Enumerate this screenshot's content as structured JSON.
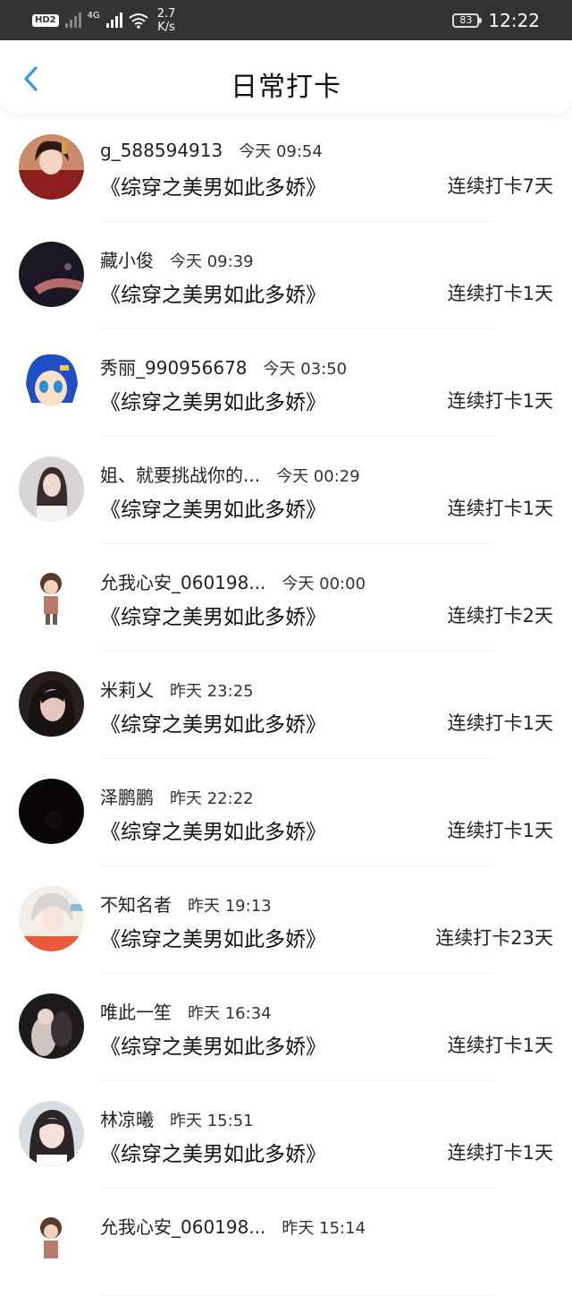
{
  "status_bar": {
    "hd": "HD",
    "sim": "2",
    "network": "4G",
    "speed_value": "2.7",
    "speed_unit": "K/s",
    "battery": "83",
    "time": "12:22"
  },
  "header": {
    "title": "日常打卡"
  },
  "colors": {
    "accent": "#2b9bf4",
    "status_bar_bg": "#333333"
  },
  "entries": [
    {
      "name": "g_588594913",
      "time": "今天 09:54",
      "book": "《综穿之美男如此多娇》",
      "streak": "连续打卡7天"
    },
    {
      "name": "藏小俊",
      "time": "今天 09:39",
      "book": "《综穿之美男如此多娇》",
      "streak": "连续打卡1天"
    },
    {
      "name": "秀丽_990956678",
      "time": "今天 03:50",
      "book": "《综穿之美男如此多娇》",
      "streak": "连续打卡1天"
    },
    {
      "name": "姐、就要挑战你的...",
      "time": "今天 00:29",
      "book": "《综穿之美男如此多娇》",
      "streak": "连续打卡1天"
    },
    {
      "name": "允我心安_060198...",
      "time": "今天 00:00",
      "book": "《综穿之美男如此多娇》",
      "streak": "连续打卡2天"
    },
    {
      "name": "米莉乂",
      "time": "昨天 23:25",
      "book": "《综穿之美男如此多娇》",
      "streak": "连续打卡1天"
    },
    {
      "name": "泽鹏鹏",
      "time": "昨天 22:22",
      "book": "《综穿之美男如此多娇》",
      "streak": "连续打卡1天"
    },
    {
      "name": "不知名者",
      "time": "昨天 19:13",
      "book": "《综穿之美男如此多娇》",
      "streak": "连续打卡23天"
    },
    {
      "name": "唯此一笙",
      "time": "昨天 16:34",
      "book": "《综穿之美男如此多娇》",
      "streak": "连续打卡1天"
    },
    {
      "name": "林凉曦",
      "time": "昨天 15:51",
      "book": "《综穿之美男如此多娇》",
      "streak": "连续打卡1天"
    },
    {
      "name": "允我心安_060198...",
      "time": "昨天 15:14",
      "book": "",
      "streak": ""
    }
  ]
}
